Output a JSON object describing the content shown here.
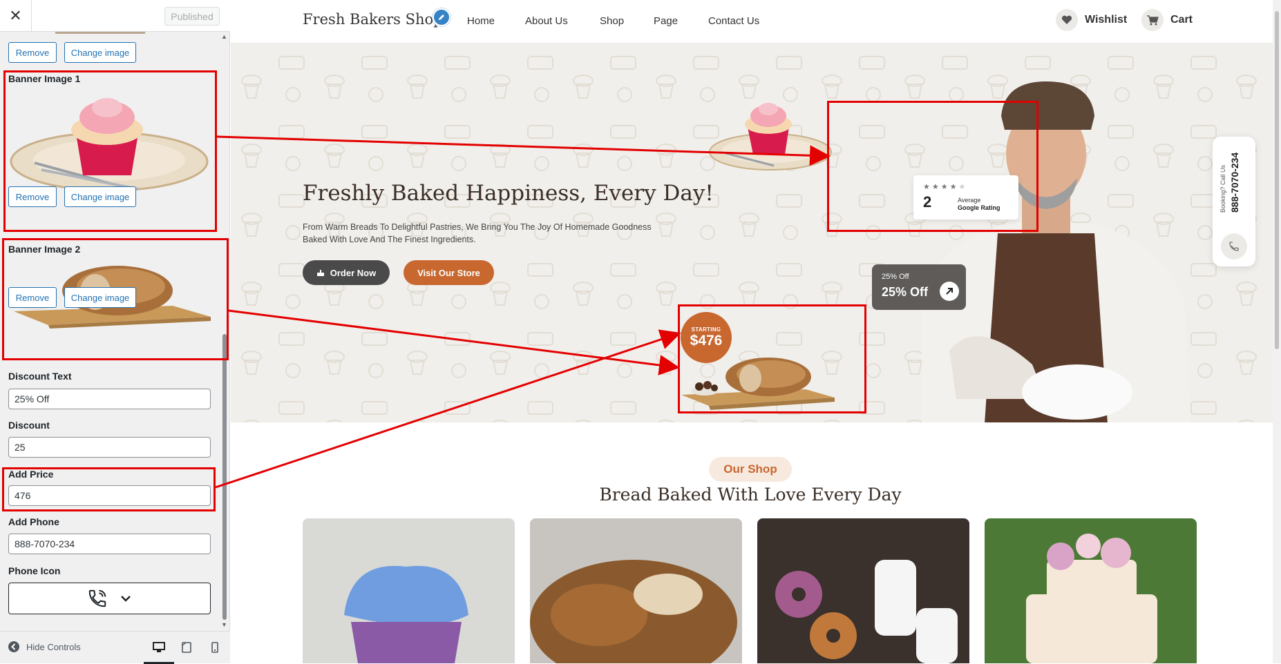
{
  "sidebar": {
    "close_label": "✕",
    "publish_label": "Published",
    "top_remove": "Remove",
    "top_change": "Change image",
    "banner1": {
      "label": "Banner Image 1",
      "remove": "Remove",
      "change": "Change image"
    },
    "banner2": {
      "label": "Banner Image 2",
      "remove": "Remove",
      "change": "Change image"
    },
    "discount_text": {
      "label": "Discount Text",
      "value": "25% Off"
    },
    "discount": {
      "label": "Discount",
      "value": "25"
    },
    "price": {
      "label": "Add Price",
      "value": "476"
    },
    "phone": {
      "label": "Add Phone",
      "value": "888-7070-234"
    },
    "phone_icon": {
      "label": "Phone Icon"
    },
    "footer": {
      "hide_controls": "Hide Controls"
    }
  },
  "site": {
    "logo": "Fresh Bakers Shop",
    "nav": [
      "Home",
      "About Us",
      "Shop",
      "Page",
      "Contact Us"
    ],
    "wishlist": "Wishlist",
    "cart": "Cart"
  },
  "hero": {
    "title": "Freshly Baked Happiness, Every Day!",
    "subtitle": "From Warm Breads To Delightful Pastries, We Bring You The Joy Of Homemade Goodness Baked With Love And The Finest Ingredients.",
    "order_btn": "Order Now",
    "visit_btn": "Visit Our Store",
    "rating": {
      "number": "2",
      "line1": "Average",
      "line2": "Google Rating",
      "stars_filled": 4,
      "stars_total": 5
    },
    "discount_card": {
      "small": "25% Off",
      "big": "25% Off"
    },
    "phone_card": {
      "small": "Booking? Call Us",
      "number": "888-7070-234"
    },
    "price_badge": {
      "label": "STARTING",
      "price": "$476"
    }
  },
  "shop": {
    "pill": "Our Shop",
    "title": "Bread Baked With Love Every Day"
  },
  "colors": {
    "accent": "#c8672e",
    "highlight": "#e30000",
    "wp_blue": "#2271b1"
  }
}
